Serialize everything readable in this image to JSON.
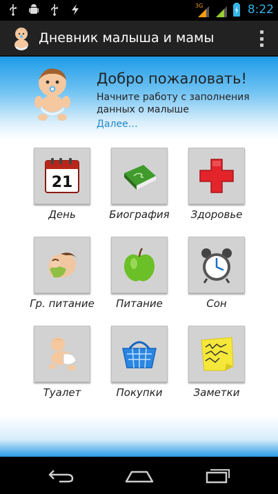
{
  "status_bar": {
    "time": "8:22",
    "network": "3G",
    "icons": [
      "usb-icon",
      "android-debug-icon",
      "usb-icon",
      "lightning-icon"
    ]
  },
  "app_bar": {
    "title": "Дневник малыша и мамы",
    "logo_icon": "baby-icon",
    "overflow_icon": "overflow-menu-icon"
  },
  "welcome": {
    "title": "Добро пожаловать!",
    "text": "Начните работу с заполнения данных о малыше",
    "link": "Далее…"
  },
  "menu": [
    {
      "id": "day",
      "label": "День",
      "icon": "calendar-icon",
      "calendar_number": "21"
    },
    {
      "id": "biography",
      "label": "Биография",
      "icon": "book-icon"
    },
    {
      "id": "health",
      "label": "Здоровье",
      "icon": "red-cross-icon"
    },
    {
      "id": "breastfeeding",
      "label": "Гр. питание",
      "icon": "breastfeeding-icon"
    },
    {
      "id": "feeding",
      "label": "Питание",
      "icon": "apple-icon"
    },
    {
      "id": "sleep",
      "label": "Сон",
      "icon": "alarm-clock-icon"
    },
    {
      "id": "toilet",
      "label": "Туалет",
      "icon": "crawling-baby-icon"
    },
    {
      "id": "shopping",
      "label": "Покупки",
      "icon": "shopping-basket-icon"
    },
    {
      "id": "notes",
      "label": "Заметки",
      "icon": "sticky-note-icon"
    }
  ],
  "nav_bar": {
    "back": "back-icon",
    "home": "home-icon",
    "recent": "recent-apps-icon"
  },
  "colors": {
    "accent": "#33b5e5",
    "link": "#1f88c9",
    "header_gradient_top": "#1e9be8",
    "tile_bg": "#d2d2d2"
  }
}
